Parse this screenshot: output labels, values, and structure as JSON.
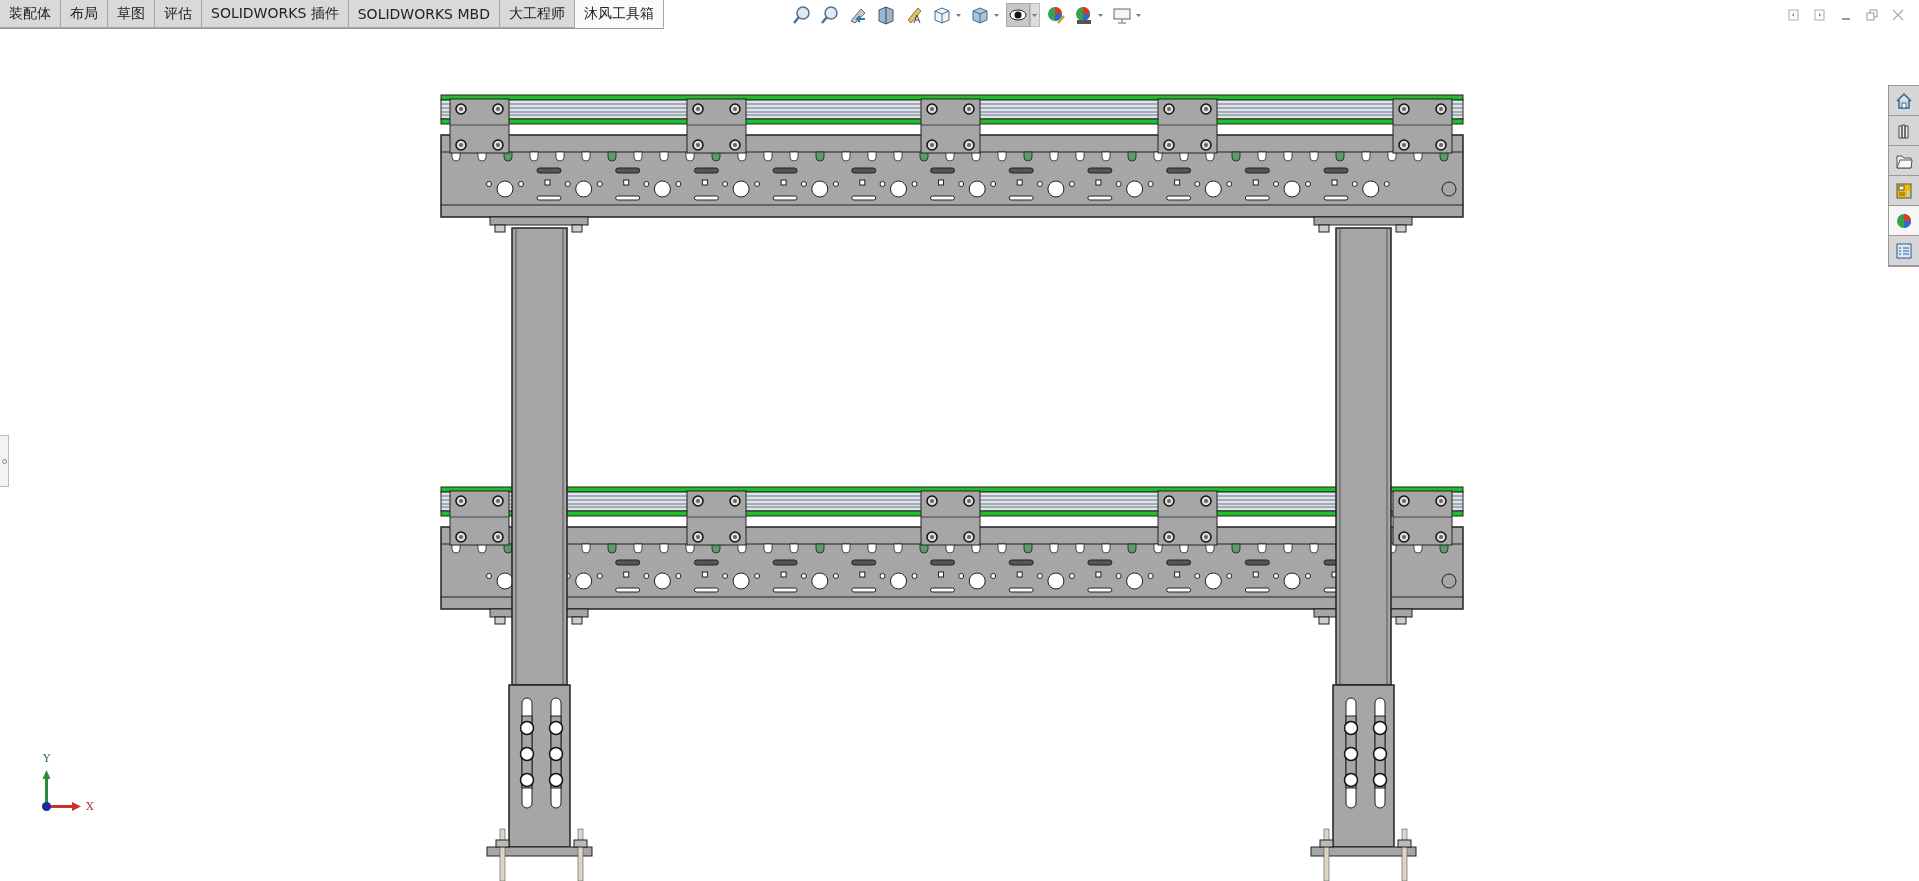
{
  "tabs": [
    {
      "label": "装配体",
      "selected": false
    },
    {
      "label": "布局",
      "selected": false
    },
    {
      "label": "草图",
      "selected": false
    },
    {
      "label": "评估",
      "selected": false
    },
    {
      "label": "SOLIDWORKS 插件",
      "selected": false
    },
    {
      "label": "SOLIDWORKS MBD",
      "selected": false
    },
    {
      "label": "大工程师",
      "selected": false
    },
    {
      "label": "沐风工具箱",
      "selected": true
    }
  ],
  "view_toolbar": [
    {
      "kind": "zoom-fit",
      "selected": false,
      "dropdown": false
    },
    {
      "kind": "zoom-area",
      "selected": false,
      "dropdown": false
    },
    {
      "kind": "previous-view",
      "selected": false,
      "dropdown": false
    },
    {
      "kind": "section-view",
      "selected": false,
      "dropdown": false
    },
    {
      "kind": "annotation",
      "selected": false,
      "dropdown": false
    },
    {
      "kind": "orientation",
      "selected": false,
      "dropdown": true
    },
    {
      "kind": "display-style",
      "selected": false,
      "dropdown": true
    },
    {
      "kind": "hide-show",
      "selected": true,
      "dropdown": true
    },
    {
      "kind": "appearance",
      "selected": false,
      "dropdown": false
    },
    {
      "kind": "scene",
      "selected": false,
      "dropdown": true
    },
    {
      "kind": "display",
      "selected": false,
      "dropdown": true
    }
  ],
  "window_controls": [
    {
      "kind": "prev"
    },
    {
      "kind": "next"
    },
    {
      "kind": "minimize"
    },
    {
      "kind": "restore"
    },
    {
      "kind": "close"
    }
  ],
  "task_pane": [
    {
      "kind": "home",
      "selected": false
    },
    {
      "kind": "library",
      "selected": false
    },
    {
      "kind": "folder",
      "selected": false
    },
    {
      "kind": "palette",
      "selected": false
    },
    {
      "kind": "appearances",
      "selected": true
    },
    {
      "kind": "properties",
      "selected": false
    }
  ],
  "triad": {
    "x_label": "X",
    "y_label": "Y"
  }
}
